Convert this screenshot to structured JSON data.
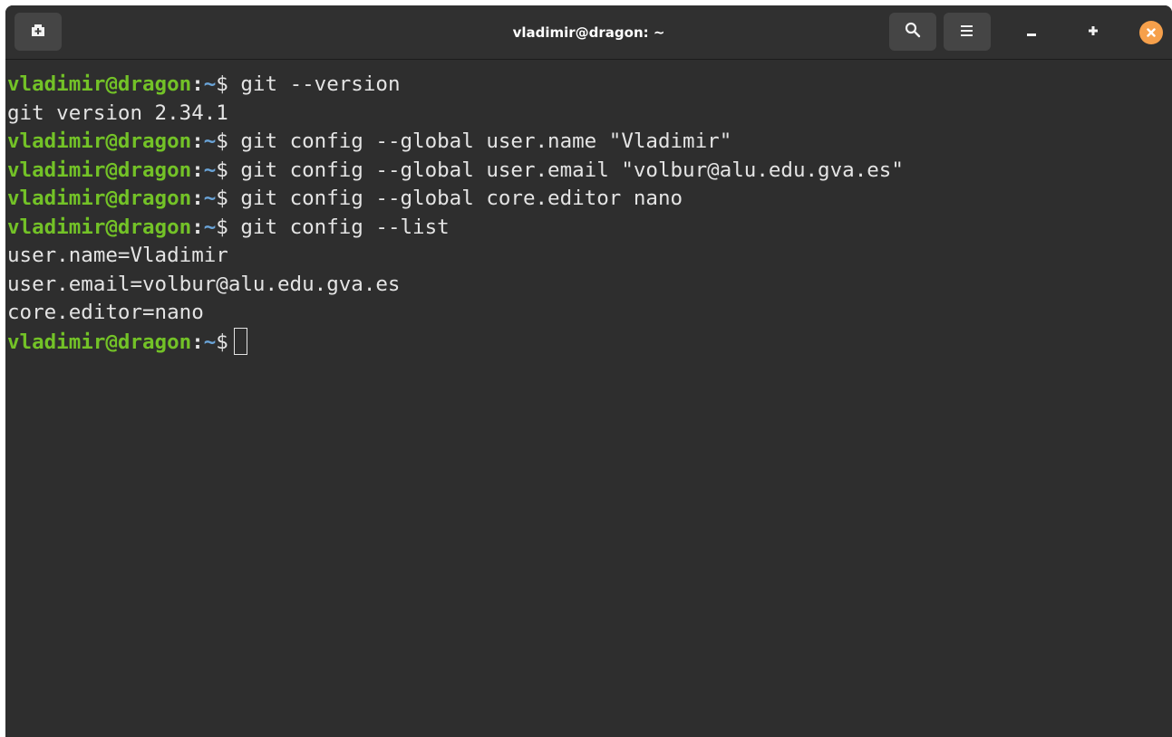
{
  "window": {
    "title": "vladimir@dragon: ~"
  },
  "titlebar": {
    "icons": [
      "new-tab-icon",
      "search-icon",
      "menu-icon",
      "minimize-icon",
      "maximize-icon",
      "close-icon"
    ]
  },
  "colors": {
    "background": "#2e2e2e",
    "prompt_user": "#73c227",
    "prompt_path": "#6aa4d8",
    "text": "#e4e4e4",
    "close_button": "#f6a04b"
  },
  "prompt": {
    "user_host": "vladimir@dragon",
    "separator": ":",
    "path": "~",
    "symbol": "$"
  },
  "terminal": {
    "lines": [
      {
        "type": "command",
        "text": "git --version"
      },
      {
        "type": "output",
        "text": "git version 2.34.1"
      },
      {
        "type": "command",
        "text": "git config --global user.name \"Vladimir\""
      },
      {
        "type": "command",
        "text": "git config --global user.email \"volbur@alu.edu.gva.es\""
      },
      {
        "type": "command",
        "text": "git config --global core.editor nano"
      },
      {
        "type": "command",
        "text": "git config --list"
      },
      {
        "type": "output",
        "text": "user.name=Vladimir"
      },
      {
        "type": "output",
        "text": "user.email=volbur@alu.edu.gva.es"
      },
      {
        "type": "output",
        "text": "core.editor=nano"
      },
      {
        "type": "command",
        "text": ""
      }
    ]
  }
}
